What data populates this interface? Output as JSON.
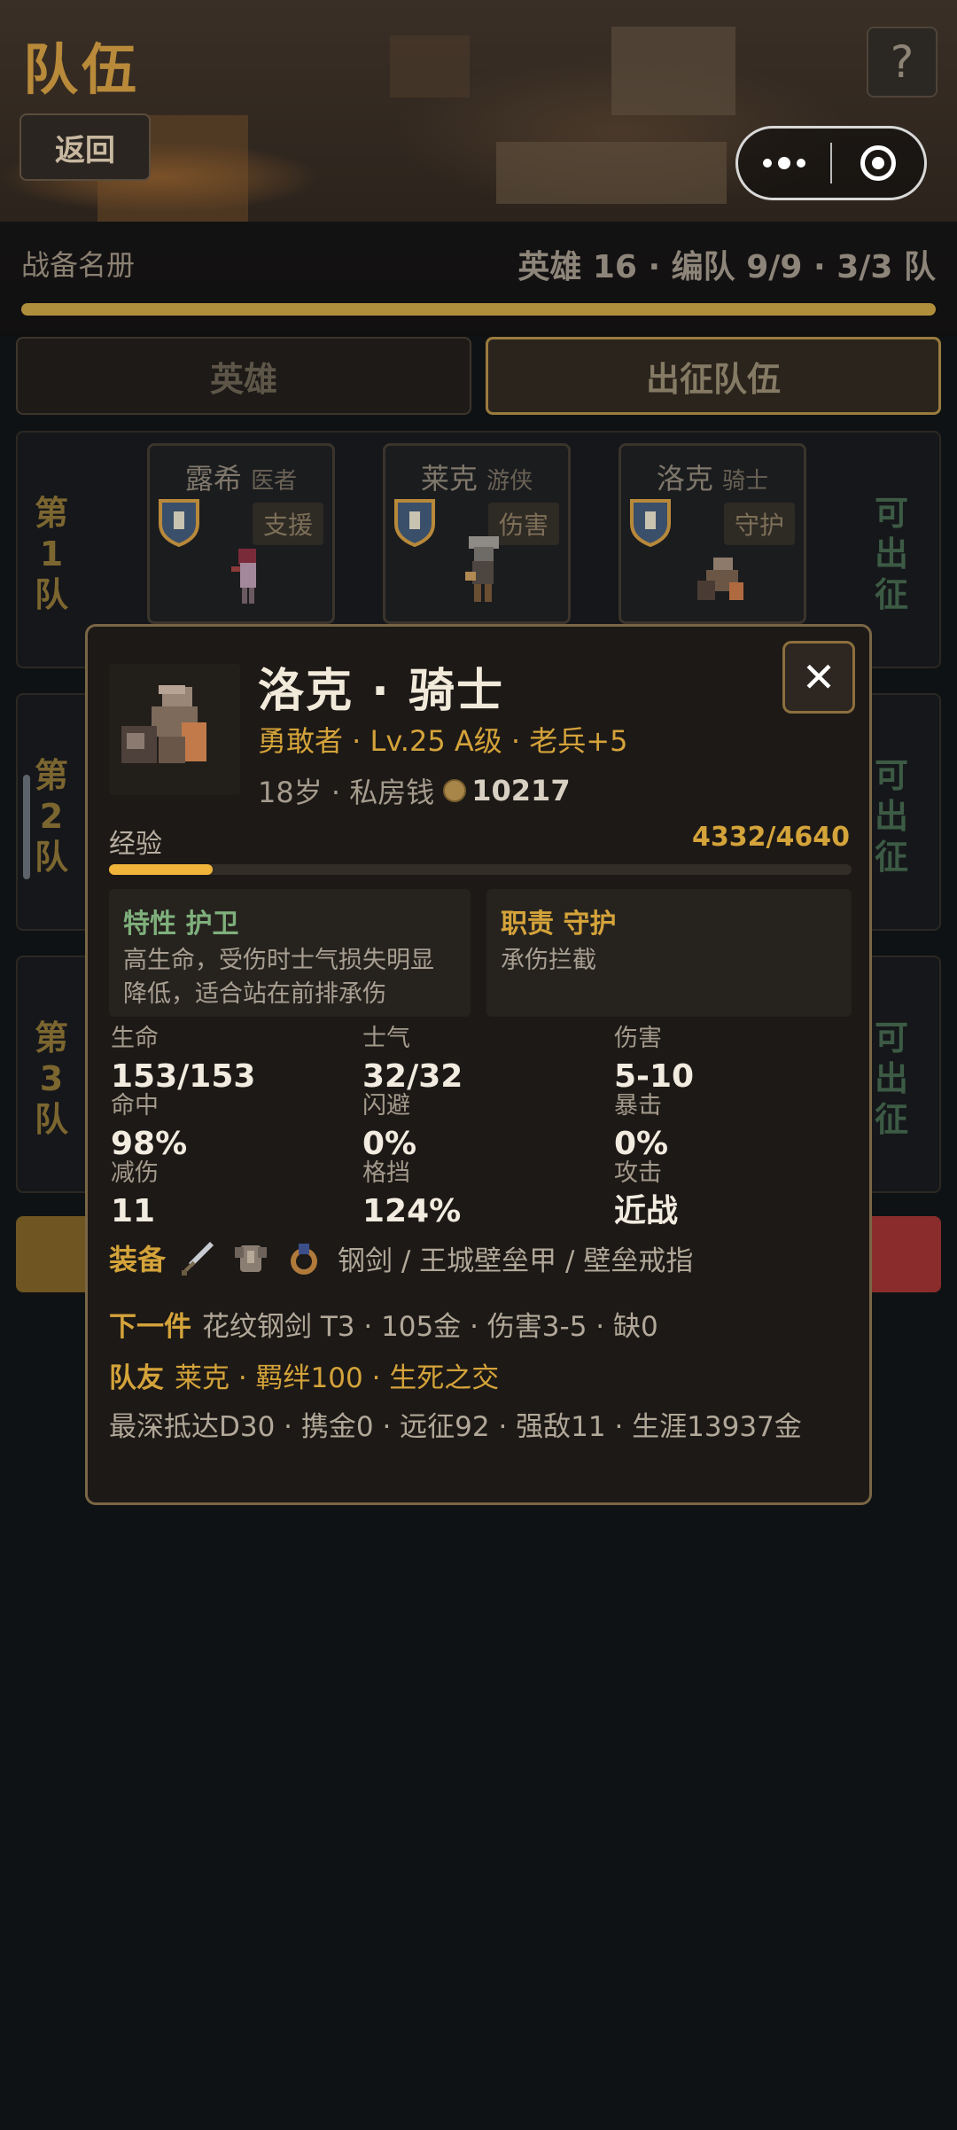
{
  "header": {
    "title": "队伍",
    "back_label": "返回",
    "help_label": "?"
  },
  "roster": {
    "label": "战备名册",
    "stats": "英雄 16 · 编队 9/9 · 3/3 队"
  },
  "tabs": [
    {
      "label": "英雄",
      "active": false
    },
    {
      "label": "出征队伍",
      "active": true
    }
  ],
  "teams": [
    {
      "label": "第1队",
      "status": "可出征",
      "members": [
        {
          "name": "露希",
          "class": "医者",
          "role": "支援"
        },
        {
          "name": "莱克",
          "class": "游侠",
          "role": "伤害"
        },
        {
          "name": "洛克",
          "class": "骑士",
          "role": "守护"
        }
      ]
    },
    {
      "label": "第2队",
      "status": "可出征"
    },
    {
      "label": "第3队",
      "status": "可出征"
    }
  ],
  "hero": {
    "name_title": "洛克 · 骑士",
    "line2": "勇敢者 · Lv.25 A级 · 老兵+5",
    "age": "18岁 · 私房钱",
    "savings": "10217",
    "exp_label": "经验",
    "exp_text": "4332/4640",
    "exp_fraction": 0.14,
    "trait_title": "特性 护卫",
    "trait_desc": "高生命，受伤时士气损失明显降低，适合站在前排承伤",
    "duty_title": "职责 守护",
    "duty_desc": "承伤拦截",
    "stats": [
      {
        "label": "生命",
        "value": "153/153"
      },
      {
        "label": "士气",
        "value": "32/32"
      },
      {
        "label": "伤害",
        "value": "5-10"
      },
      {
        "label": "命中",
        "value": "98%"
      },
      {
        "label": "闪避",
        "value": "0%"
      },
      {
        "label": "暴击",
        "value": "0%"
      },
      {
        "label": "减伤",
        "value": "11"
      },
      {
        "label": "格挡",
        "value": "124%"
      },
      {
        "label": "攻击",
        "value": "近战"
      }
    ],
    "equip_label": "装备",
    "equip_icons": [
      "sword-icon",
      "armor-icon",
      "ring-icon"
    ],
    "equip_text": "钢剑 / 王城壁垒甲 / 壁垒戒指",
    "next_label": "下一件",
    "next_text": "花纹钢剑 T3 · 105金 · 伤害3-5 · 缺0",
    "mate_label": "队友",
    "mate_text": "莱克 · 羁绊100 · 生死之交",
    "career_text": "最深抵达D30 · 携金0 · 远征92 · 强敌11 · 生涯13937金"
  },
  "colors": {
    "gold": "#d4a33a",
    "green": "#7fb07c",
    "panel": "#1d1916"
  }
}
